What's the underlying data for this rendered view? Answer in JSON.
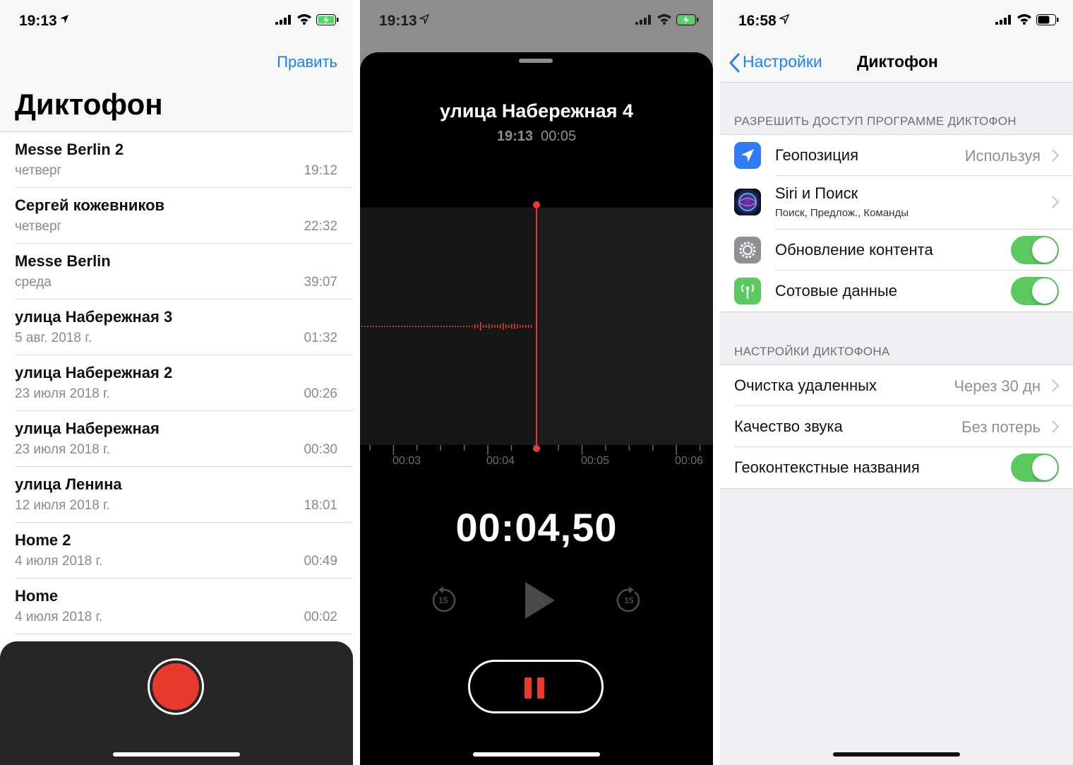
{
  "left": {
    "status_time": "19:13",
    "edit_label": "Править",
    "title": "Диктофон",
    "recordings": [
      {
        "name": "Messe Berlin 2",
        "date": "четверг",
        "duration": "19:12"
      },
      {
        "name": "Сергей кожевников",
        "date": "четверг",
        "duration": "22:32"
      },
      {
        "name": "Messe Berlin",
        "date": "среда",
        "duration": "39:07"
      },
      {
        "name": "улица Набережная 3",
        "date": "5 авг. 2018 г.",
        "duration": "01:32"
      },
      {
        "name": "улица Набережная 2",
        "date": "23 июля 2018 г.",
        "duration": "00:26"
      },
      {
        "name": "улица Набережная",
        "date": "23 июля 2018 г.",
        "duration": "00:30"
      },
      {
        "name": "улица Ленина",
        "date": "12 июля 2018 г.",
        "duration": "18:01"
      },
      {
        "name": "Home 2",
        "date": "4 июля 2018 г.",
        "duration": "00:49"
      },
      {
        "name": "Home",
        "date": "4 июля 2018 г.",
        "duration": "00:02"
      }
    ]
  },
  "middle": {
    "status_time": "19:13",
    "recording_title": "улица Набережная 4",
    "recording_time": "19:13",
    "recording_length": "00:05",
    "timeline_ticks": [
      "00:03",
      "00:04",
      "00:05",
      "00:06"
    ],
    "elapsed": "00:04,50",
    "skip_back_label": "15",
    "skip_forward_label": "15"
  },
  "right": {
    "status_time": "16:58",
    "back_label": "Настройки",
    "title": "Диктофон",
    "section_access": "РАЗРЕШИТЬ ДОСТУП ПРОГРАММЕ ДИКТОФОН",
    "access_rows": {
      "location": {
        "label": "Геопозиция",
        "value": "Используя"
      },
      "siri": {
        "label": "Siri и Поиск",
        "sublabel": "Поиск, Предлож., Команды"
      },
      "refresh": {
        "label": "Обновление контента"
      },
      "cellular": {
        "label": "Сотовые данные"
      }
    },
    "section_settings": "НАСТРОЙКИ ДИКТОФОНА",
    "settings_rows": {
      "clear": {
        "label": "Очистка удаленных",
        "value": "Через 30 дн"
      },
      "quality": {
        "label": "Качество звука",
        "value": "Без потерь"
      },
      "geo_names": {
        "label": "Геоконтекстные названия"
      }
    }
  },
  "colors": {
    "accent_blue": "#1a82fb",
    "record_red": "#e83b2e",
    "toggle_green": "#5bc95e",
    "battery_green": "#4cd964"
  }
}
